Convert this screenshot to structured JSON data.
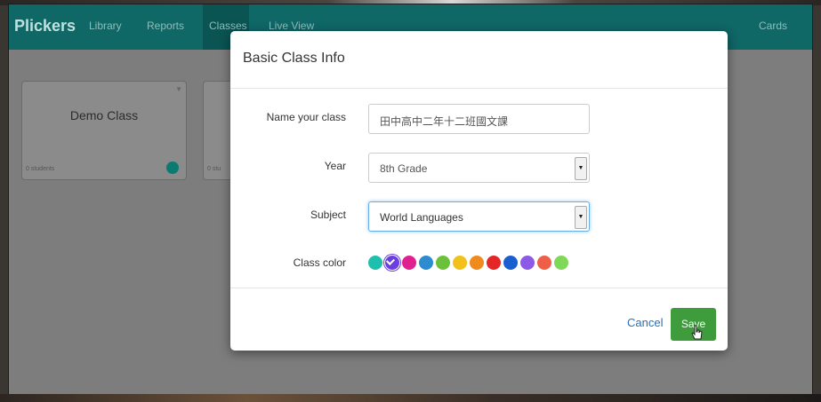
{
  "nav": {
    "brand": "Plickers",
    "links": [
      "Library",
      "Reports",
      "Classes",
      "Live View"
    ],
    "cards_link": "Cards"
  },
  "background_cards": [
    {
      "title": "Demo Class",
      "count": "0 students"
    },
    {
      "title": "",
      "count": "0 stu"
    }
  ],
  "modal": {
    "title": "Basic Class Info",
    "name_label": "Name your class",
    "name_value": "田中高中二年十二班國文課",
    "year_label": "Year",
    "year_value": "8th Grade",
    "subject_label": "Subject",
    "subject_value": "World Languages",
    "color_label": "Class color",
    "colors": [
      "#1fbfae",
      "#6a3ee0",
      "#e0208f",
      "#2d8ccf",
      "#6cc13b",
      "#f3c21a",
      "#f08a1d",
      "#e52626",
      "#1a5fd0",
      "#8d5ae8",
      "#ef5f48",
      "#7fd857"
    ],
    "selected_color_index": 1,
    "cancel_label": "Cancel",
    "save_label": "Save"
  }
}
